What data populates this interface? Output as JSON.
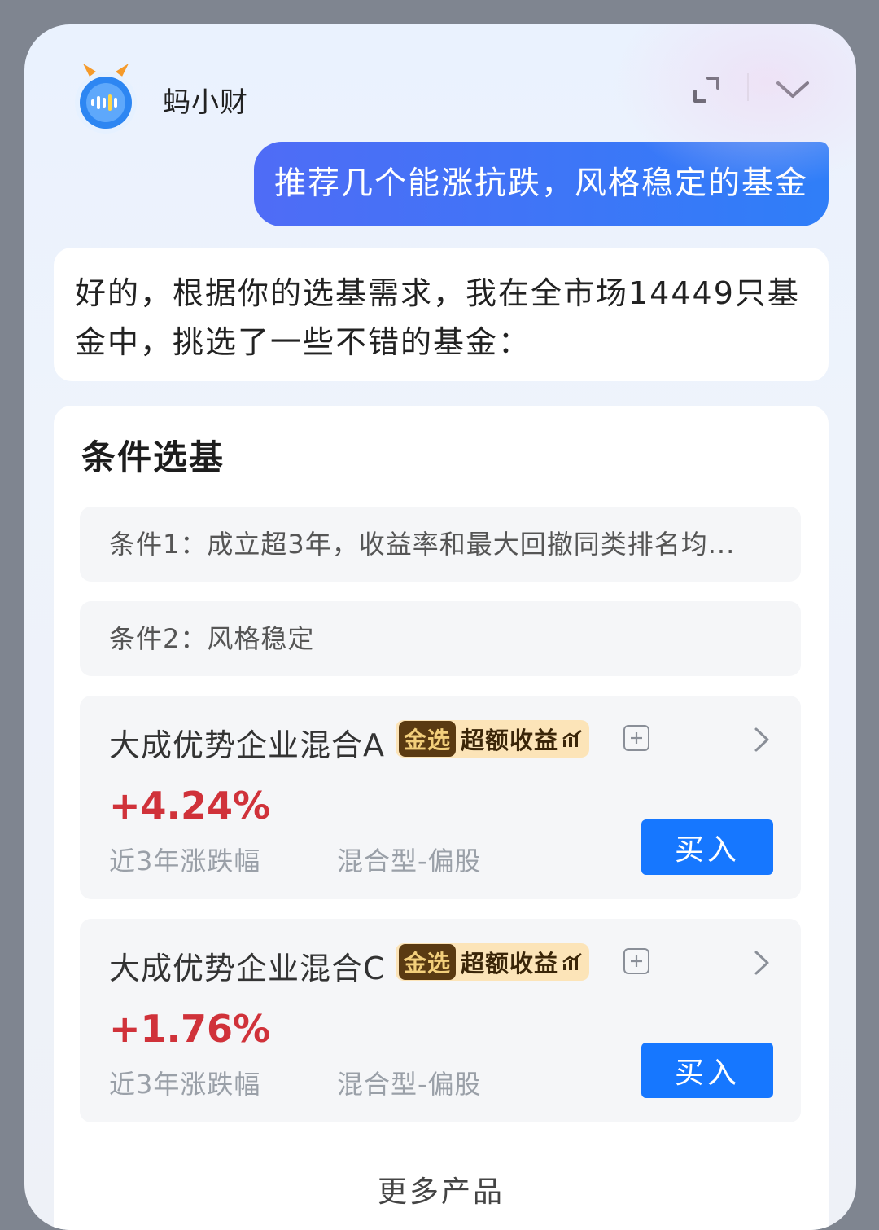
{
  "header": {
    "bot_name": "蚂小财"
  },
  "chat": {
    "user_message": "推荐几个能涨抗跌，风格稳定的基金",
    "bot_reply": "好的，根据你的选基需求，我在全市场14449只基金中，挑选了一些不错的基金："
  },
  "filter": {
    "title": "条件选基",
    "conditions": [
      "条件1：成立超3年，收益率和最大回撤同类排名均...",
      "条件2：风格稳定"
    ],
    "funds": [
      {
        "name": "大成优势企业混合A",
        "badge_tag": "金选",
        "badge_text": "超额收益",
        "return": "+4.24%",
        "return_label": "近3年涨跌幅",
        "type": "混合型-偏股",
        "buy_label": "买入"
      },
      {
        "name": "大成优势企业混合C",
        "badge_tag": "金选",
        "badge_text": "超额收益",
        "return": "+1.76%",
        "return_label": "近3年涨跌幅",
        "type": "混合型-偏股",
        "buy_label": "买入"
      }
    ],
    "more_label": "更多产品"
  },
  "colors": {
    "accent_blue": "#1677ff",
    "return_red": "#d0323a",
    "badge_bg": "#fce4b8"
  }
}
